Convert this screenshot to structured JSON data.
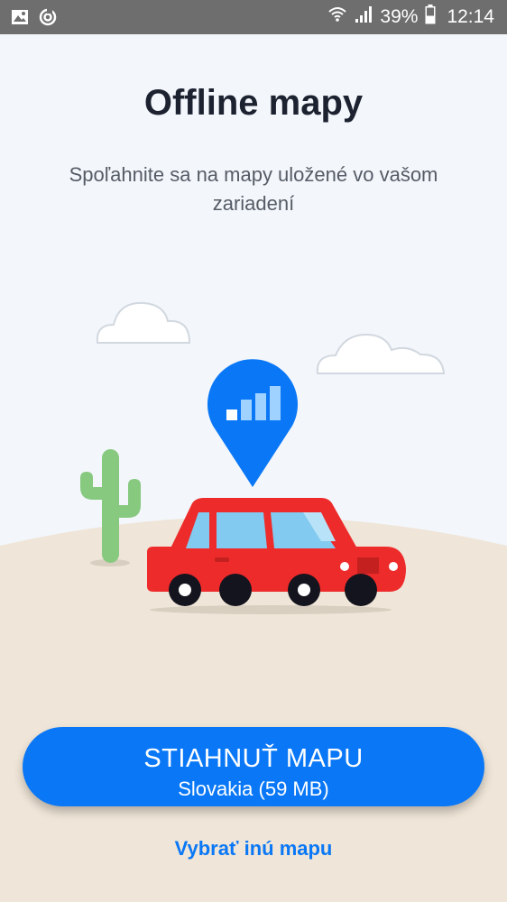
{
  "status_bar": {
    "icons": [
      "image-icon",
      "sync-icon",
      "wifi-icon",
      "signal-icon",
      "battery-icon"
    ],
    "battery": "39%",
    "time": "12:14"
  },
  "screen": {
    "title": "Offline mapy",
    "subtitle": "Spoľahnite sa na mapy uložené vo vašom zariadení"
  },
  "illustration": {
    "elements": [
      "cloud",
      "cloud",
      "map-pin-signal",
      "cactus",
      "red-car"
    ]
  },
  "actions": {
    "download_label": "STIAHNUŤ MAPU",
    "download_detail": "Slovakia (59 MB)",
    "other_map_link": "Vybrať inú mapu"
  },
  "colors": {
    "accent": "#0a78f6",
    "car": "#ee2b2b",
    "cactus": "#86c97f",
    "ground": "#efe5d8",
    "sky": "#f3f6fb",
    "status_bar": "#6e6e6e"
  }
}
